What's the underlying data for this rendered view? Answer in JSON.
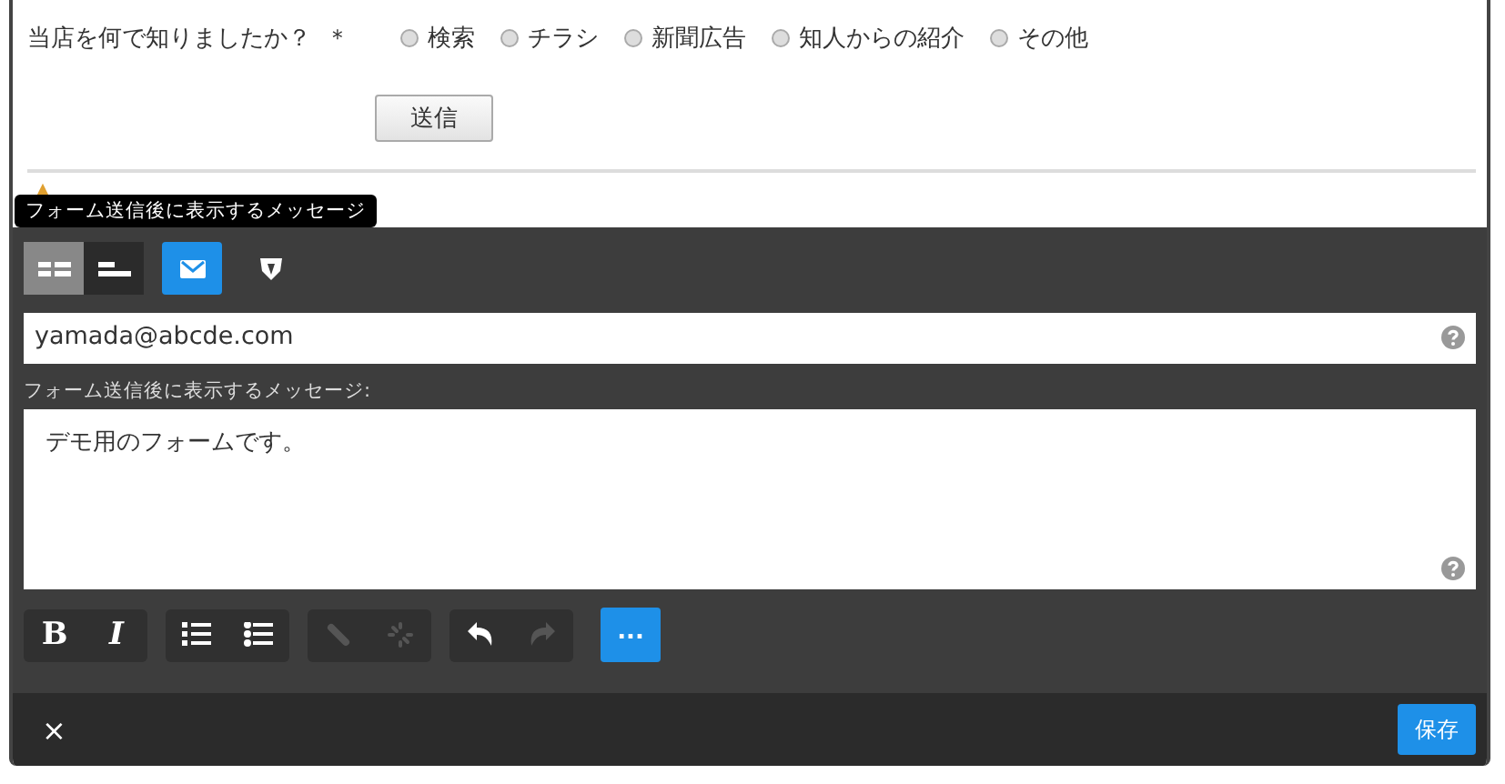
{
  "form": {
    "question": "当店を何で知りましたか？",
    "required_mark": "＊",
    "options": [
      {
        "label": "検索",
        "selected": false
      },
      {
        "label": "チラシ",
        "selected": false
      },
      {
        "label": "新聞広告",
        "selected": false
      },
      {
        "label": "知人からの紹介",
        "selected": false
      },
      {
        "label": "その他",
        "selected": false
      }
    ],
    "submit": "送信"
  },
  "tooltip": "フォーム送信後に表示するメッセージ",
  "mode_buttons": [
    {
      "kind": "two-column",
      "selected": true
    },
    {
      "kind": "one-column",
      "selected": false
    },
    {
      "kind": "mail",
      "selected": true
    },
    {
      "kind": "shield",
      "selected": false
    }
  ],
  "email": {
    "value": "yamada@abcde.com"
  },
  "message": {
    "label": "フォーム送信後に表示するメッセージ:",
    "value": "デモ用のフォームです。"
  },
  "toolbar": [
    [
      {
        "kind": "bold",
        "text": "B",
        "disabled": false
      },
      {
        "kind": "italic",
        "text": "I",
        "disabled": false
      }
    ],
    [
      {
        "kind": "ordered-list",
        "disabled": false
      },
      {
        "kind": "bullet-list",
        "disabled": false
      }
    ],
    [
      {
        "kind": "link",
        "disabled": true
      },
      {
        "kind": "unlink",
        "disabled": true
      }
    ],
    [
      {
        "kind": "undo",
        "disabled": false
      },
      {
        "kind": "redo",
        "disabled": true
      }
    ]
  ],
  "more": "...",
  "footer": {
    "close": "×",
    "save": "保存"
  }
}
